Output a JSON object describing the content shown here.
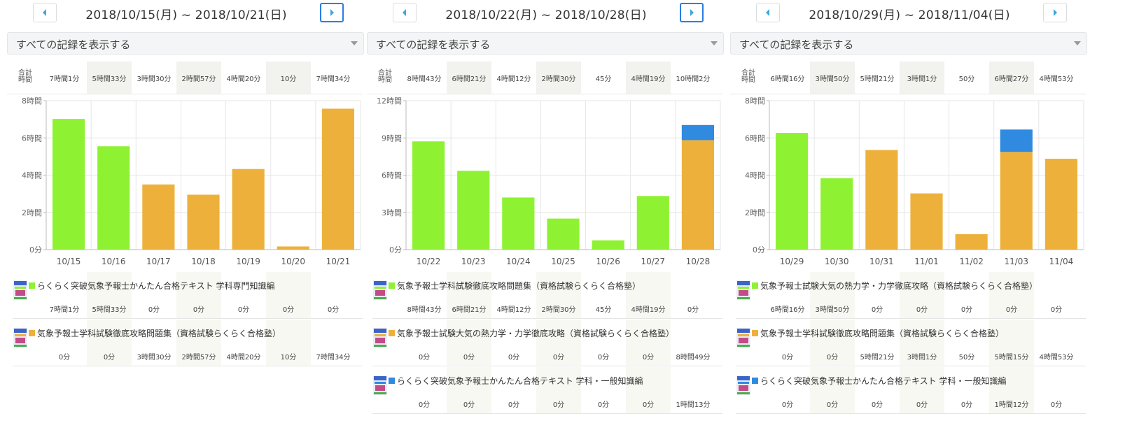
{
  "colors": {
    "green": "#8ef232",
    "orange": "#edb13b",
    "blue": "#2f8ae0",
    "active_border": "#2a7ee0",
    "arrow": "#3aa7e0"
  },
  "icons": {
    "prev": "caret-left-icon",
    "next": "caret-right-icon",
    "dropdown": "caret-down-icon"
  },
  "panels": [
    {
      "date_range": "2018/10/15(月) ~ 2018/10/21(日)",
      "next_active": true,
      "filter_label": "すべての記録を表示する",
      "totals_label": [
        "合計",
        "時間"
      ],
      "totals": [
        "7時間1分",
        "5時間33分",
        "3時間30分",
        "2時間57分",
        "4時間20分",
        "10分",
        "7時間34分"
      ],
      "chart_data": {
        "type": "bar",
        "stacked": true,
        "categories": [
          "10/15",
          "10/16",
          "10/17",
          "10/18",
          "10/19",
          "10/20",
          "10/21"
        ],
        "ylim": [
          0,
          8
        ],
        "yticks": [
          0,
          2,
          4,
          6,
          8
        ],
        "ytick_labels": [
          "0分",
          "2時間",
          "4時間",
          "6時間",
          "8時間"
        ],
        "grid": true,
        "series": [
          {
            "color": "#8ef232",
            "values": [
              7.02,
              5.55,
              0,
              0,
              0,
              0,
              0
            ]
          },
          {
            "color": "#edb13b",
            "values": [
              0,
              0,
              3.5,
              2.95,
              4.33,
              0.17,
              7.57
            ]
          }
        ]
      },
      "books": [
        {
          "title": "らくらく突破気象予報士かんたん合格テキスト 学科専門知識編",
          "color": "#8ef232",
          "values": [
            "7時間1分",
            "5時間33分",
            "0分",
            "0分",
            "0分",
            "0分",
            "0分"
          ]
        },
        {
          "title": "気象予報士学科試験徹底攻略問題集（資格試験らくらく合格塾）",
          "color": "#edb13b",
          "values": [
            "0分",
            "0分",
            "3時間30分",
            "2時間57分",
            "4時間20分",
            "10分",
            "7時間34分"
          ]
        }
      ]
    },
    {
      "date_range": "2018/10/22(月) ~ 2018/10/28(日)",
      "next_active": true,
      "filter_label": "すべての記録を表示する",
      "totals_label": [
        "合計",
        "時間"
      ],
      "totals": [
        "8時間43分",
        "6時間21分",
        "4時間12分",
        "2時間30分",
        "45分",
        "4時間19分",
        "10時間2分"
      ],
      "chart_data": {
        "type": "bar",
        "stacked": true,
        "categories": [
          "10/22",
          "10/23",
          "10/24",
          "10/25",
          "10/26",
          "10/27",
          "10/28"
        ],
        "ylim": [
          0,
          12
        ],
        "yticks": [
          0,
          3,
          6,
          9,
          12
        ],
        "ytick_labels": [
          "0分",
          "3時間",
          "6時間",
          "9時間",
          "12時間"
        ],
        "grid": true,
        "series": [
          {
            "color": "#8ef232",
            "values": [
              8.72,
              6.35,
              4.2,
              2.5,
              0.75,
              4.32,
              0
            ]
          },
          {
            "color": "#edb13b",
            "values": [
              0,
              0,
              0,
              0,
              0,
              0,
              8.82
            ]
          },
          {
            "color": "#2f8ae0",
            "values": [
              0,
              0,
              0,
              0,
              0,
              0,
              1.22
            ]
          }
        ]
      },
      "books": [
        {
          "title": "気象予報士学科試験徹底攻略問題集（資格試験らくらく合格塾）",
          "color": "#8ef232",
          "values": [
            "8時間43分",
            "6時間21分",
            "4時間12分",
            "2時間30分",
            "45分",
            "4時間19分",
            "0分"
          ]
        },
        {
          "title": "気象予報士試験大気の熱力学・力学徹底攻略（資格試験らくらく合格塾）",
          "color": "#edb13b",
          "values": [
            "0分",
            "0分",
            "0分",
            "0分",
            "0分",
            "0分",
            "8時間49分"
          ]
        },
        {
          "title": "らくらく突破気象予報士かんたん合格テキスト 学科・一般知識編",
          "color": "#2f8ae0",
          "values": [
            "0分",
            "0分",
            "0分",
            "0分",
            "0分",
            "0分",
            "1時間13分"
          ]
        }
      ]
    },
    {
      "date_range": "2018/10/29(月) ~ 2018/11/04(日)",
      "next_active": false,
      "filter_label": "すべての記録を表示する",
      "totals_label": [
        "合計",
        "時間"
      ],
      "totals": [
        "6時間16分",
        "3時間50分",
        "5時間21分",
        "3時間1分",
        "50分",
        "6時間27分",
        "4時間53分"
      ],
      "chart_data": {
        "type": "bar",
        "stacked": true,
        "categories": [
          "10/29",
          "10/30",
          "10/31",
          "11/01",
          "11/02",
          "11/03",
          "11/04"
        ],
        "ylim": [
          0,
          8
        ],
        "yticks": [
          0,
          2,
          4,
          6,
          8
        ],
        "ytick_labels": [
          "0分",
          "2時間",
          "4時間",
          "6時間",
          "8時間"
        ],
        "grid": true,
        "series": [
          {
            "color": "#8ef232",
            "values": [
              6.27,
              3.83,
              0,
              0,
              0,
              0,
              0
            ]
          },
          {
            "color": "#edb13b",
            "values": [
              0,
              0,
              5.35,
              3.02,
              0.83,
              5.25,
              4.88
            ]
          },
          {
            "color": "#2f8ae0",
            "values": [
              0,
              0,
              0,
              0,
              0,
              1.2,
              0
            ]
          }
        ]
      },
      "books": [
        {
          "title": "気象予報士試験大気の熱力学・力学徹底攻略（資格試験らくらく合格塾）",
          "color": "#8ef232",
          "values": [
            "6時間16分",
            "3時間50分",
            "0分",
            "0分",
            "0分",
            "0分",
            "0分"
          ]
        },
        {
          "title": "気象予報士学科試験徹底攻略問題集（資格試験らくらく合格塾）",
          "color": "#edb13b",
          "values": [
            "0分",
            "0分",
            "5時間21分",
            "3時間1分",
            "50分",
            "5時間15分",
            "4時間53分"
          ]
        },
        {
          "title": "らくらく突破気象予報士かんたん合格テキスト 学科・一般知識編",
          "color": "#2f8ae0",
          "values": [
            "0分",
            "0分",
            "0分",
            "0分",
            "0分",
            "1時間12分",
            "0分"
          ]
        }
      ]
    }
  ]
}
